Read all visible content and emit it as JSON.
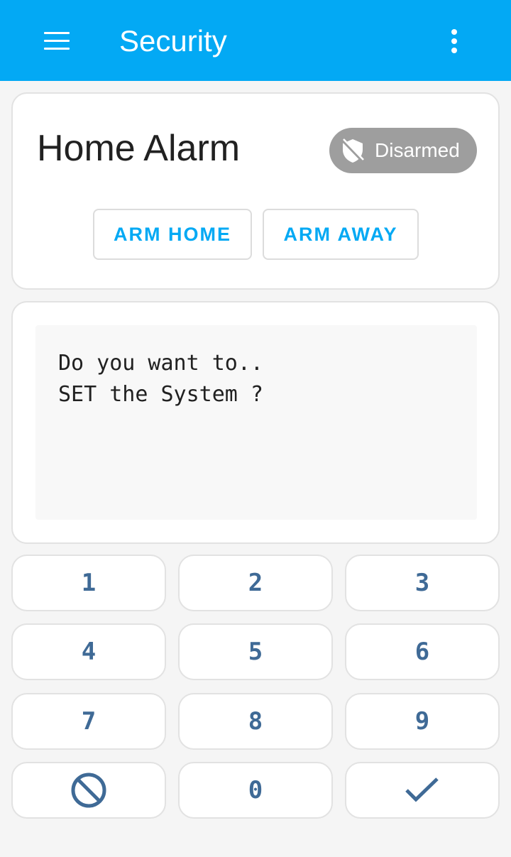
{
  "app_bar": {
    "title": "Security",
    "menu_icon": "hamburger-menu-icon",
    "more_icon": "more-vertical-icon",
    "background_color": "#03a9f4"
  },
  "alarm_card": {
    "name": "Home Alarm",
    "status": {
      "label": "Disarmed",
      "icon": "shield-off-icon",
      "color": "#9e9e9e"
    },
    "buttons": {
      "arm_home": "ARM HOME",
      "arm_away": "ARM AWAY"
    },
    "accent_color": "#03a9f4"
  },
  "message_card": {
    "line1": "Do you want to..",
    "line2": "SET the System ?"
  },
  "keypad": {
    "keys": [
      "1",
      "2",
      "3",
      "4",
      "5",
      "6",
      "7",
      "8",
      "9",
      "0"
    ],
    "clear_icon": "cancel-circle-icon",
    "confirm_icon": "checkmark-icon",
    "key_color": "#3f6a96"
  }
}
